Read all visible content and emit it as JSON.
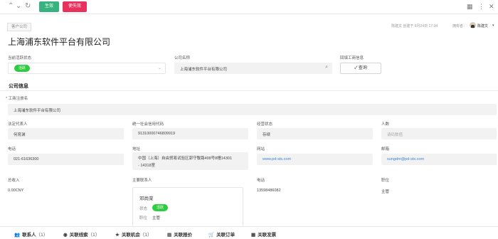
{
  "toolbar": {
    "btn_generate": "生效",
    "btn_invalidate": "使失效"
  },
  "header": {
    "breadcrumb": "客户公司",
    "meta_owner_info": "陈建文 创建于 6月24日 17:34",
    "owner_label": "拥有者：",
    "owner_name": "陈建文",
    "company_title": "上海浦东软件平台有限公司"
  },
  "top_fields": {
    "status_label": "当前活跃状态",
    "status_value": "活跃",
    "company_name_label": "公司名称",
    "company_name_value": "上海浦东软件平台有限公司",
    "backfill_label": "回填工商信息",
    "query_button": "查询"
  },
  "section_title": "公司信息",
  "business_name": {
    "label": "工商注册名",
    "value": "上海浦东软件平台有限公司"
  },
  "fields": {
    "legal_rep_label": "法定代表人",
    "legal_rep_value": "何育渊",
    "credit_code_label": "统一社会信用代码",
    "credit_code_value": "91310000746809919",
    "biz_status_label": "经营状态",
    "biz_status_value": "存续",
    "staff_label": "人数",
    "staff_value": "请码数值",
    "phone_label": "电话",
    "phone_value": "021-61636300",
    "address_label": "地址",
    "address_line1": "中国（上海）自由贸易试验区郭守敬路498号8幢14301",
    "address_line2": "- 14318室",
    "website_label": "网站",
    "website_value": "www.pd-sts.com",
    "email_label": "邮箱",
    "email_value": "sungdm@pd-sts.com",
    "revenue_label": "总收入",
    "revenue_value": "0.00CNY",
    "main_contact_label": "主要联系人",
    "contact_phone_label": "电话",
    "contact_phone_value": "13598486082",
    "position_label": "职位",
    "position_value": "主管"
  },
  "contact_card": {
    "name": "邓尚荣",
    "status_label": "状态",
    "status_value": "活跃",
    "position_label": "职位",
    "position_value": "主管"
  },
  "tabs": [
    {
      "icon": "contacts-icon",
      "glyph": "👥",
      "label": "联系人",
      "count": "（1）"
    },
    {
      "icon": "lead-icon",
      "glyph": "◉",
      "label": "关联线索",
      "count": "（1）"
    },
    {
      "icon": "star-icon",
      "glyph": "★",
      "label": "关联机会",
      "count": "（1）"
    },
    {
      "icon": "quote-icon",
      "glyph": "▤",
      "label": "关联报价",
      "count": ""
    },
    {
      "icon": "order-icon",
      "glyph": "🛒",
      "label": "关联订单",
      "count": ""
    },
    {
      "icon": "invoice-icon",
      "glyph": "▦",
      "label": "关联发票",
      "count": ""
    }
  ],
  "colors": {
    "green": "#36b37e",
    "red": "#e8315d",
    "pill": "#2ecc40",
    "link": "#3c7fd8"
  }
}
